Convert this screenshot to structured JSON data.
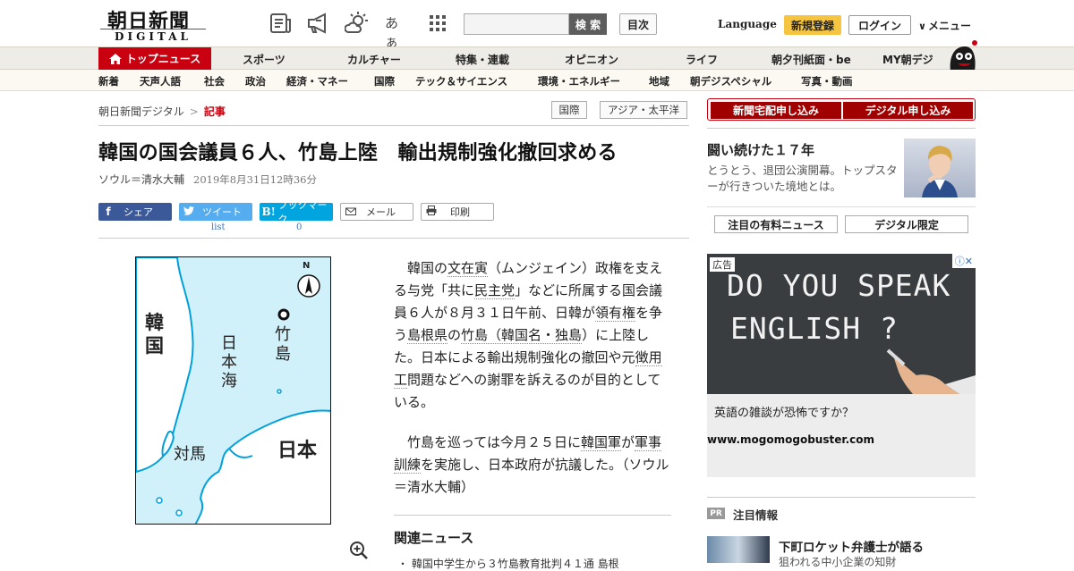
{
  "header": {
    "logo_main": "朝日新聞",
    "logo_sub": "DIGITAL",
    "kana_icon": "あぁ",
    "search_placeholder": "",
    "search_label": "検 索",
    "toc_label": "目次",
    "language_label": "Language",
    "signup_label": "新規登録",
    "login_label": "ログイン",
    "menu_label": "メニュー",
    "icons": [
      "newspaper-icon",
      "megaphone-icon",
      "weather-icon",
      "font-size-icon",
      "grid-menu-icon"
    ]
  },
  "nav_primary": {
    "top_news": "トップニュース",
    "items": [
      "スポーツ",
      "カルチャー",
      "特集・連載",
      "オピニオン",
      "ライフ",
      "朝夕刊紙面・be",
      "MY朝デジ"
    ]
  },
  "nav_secondary": {
    "items": [
      "新着",
      "天声人語",
      "社会",
      "政治",
      "経済・マネー",
      "国際",
      "テック＆サイエンス",
      "環境・エネルギー",
      "地域",
      "朝デジスペシャル",
      "写真・動画"
    ]
  },
  "breadcrumb": {
    "home": "朝日新聞デジタル",
    "separator": ">",
    "current": "記事"
  },
  "tags": [
    "国際",
    "アジア・太平洋"
  ],
  "article": {
    "title": "韓国の国会議員６人、竹島上陸　輸出規制強化撤回求める",
    "author": "ソウル＝清水大輔",
    "date": "2019年8月31日12時36分",
    "share": {
      "facebook": "シェア",
      "twitter": "ツイート",
      "twitter_count": "list",
      "hatena": "ブックマーク",
      "hatena_count": "0",
      "mail": "メール",
      "print": "印刷"
    },
    "map_labels": {
      "north": "N",
      "korea": "韓国",
      "sea": "日本海",
      "takeshima": "竹島",
      "tsushima": "対馬",
      "japan": "日本"
    },
    "body": {
      "p1": [
        {
          "t": "韓国の",
          "kw": false
        },
        {
          "t": "文在寅",
          "kw": true
        },
        {
          "t": "（ムンジェイン）政権を支える与党「共に",
          "kw": false
        },
        {
          "t": "民主党",
          "kw": true
        },
        {
          "t": "」などに所属する国会議員６人が８月３１日午前、日韓が",
          "kw": false
        },
        {
          "t": "領有権",
          "kw": true
        },
        {
          "t": "を争う",
          "kw": false
        },
        {
          "t": "島根県",
          "kw": true
        },
        {
          "t": "の",
          "kw": false
        },
        {
          "t": "竹島（韓国名・独島",
          "kw": true
        },
        {
          "t": "）に上陸した。日本による輸出規制強化の撤回や元",
          "kw": false
        },
        {
          "t": "徴用工",
          "kw": true
        },
        {
          "t": "問題などへの謝罪を訴えるのが目的としている。",
          "kw": false
        }
      ],
      "p2": [
        {
          "t": "竹島を巡っては今月２５日に",
          "kw": false
        },
        {
          "t": "韓国軍",
          "kw": true
        },
        {
          "t": "が",
          "kw": false
        },
        {
          "t": "軍事訓練",
          "kw": true
        },
        {
          "t": "を実施し、日本政府が抗議した。（ソウル＝清水大輔）",
          "kw": false
        }
      ]
    },
    "related_title": "関連ニュース",
    "related_item": "・ 韓国中学生から３竹島教育批判４１通 島根"
  },
  "sidebar": {
    "subscribe_paper": "新聞宅配申し込み",
    "subscribe_digital": "デジタル申し込み",
    "feature_title": "闘い続けた１７年",
    "feature_desc": "とうとう、退団公演開幕。トップスターが行きついた境地とは。",
    "box_paid": "注目の有料ニュース",
    "box_digital": "デジタル限定",
    "ad": {
      "label": "広告",
      "close": "ⓘ✕",
      "board_line1": "DO YOU SPEAK",
      "board_line2": "ENGLISH ?",
      "text": "英語の雑談が恐怖ですか？",
      "url": "www.mogomogobuster.com"
    },
    "pr": {
      "badge": "PR",
      "title": "注目情報",
      "headline": "下町ロケット弁護士が語る",
      "sub": "狙われる中小企業の知財"
    }
  },
  "colors": {
    "brand_red": "#c8000f",
    "subscribe_red": "#a10000",
    "signup_yellow": "#f5c542",
    "facebook_blue": "#3b5998",
    "twitter_blue": "#55acee",
    "hatena_blue": "#00a4de",
    "map_sea": "#d0f0fa",
    "map_land": "#ffffff",
    "map_coast": "#00a0dc"
  }
}
